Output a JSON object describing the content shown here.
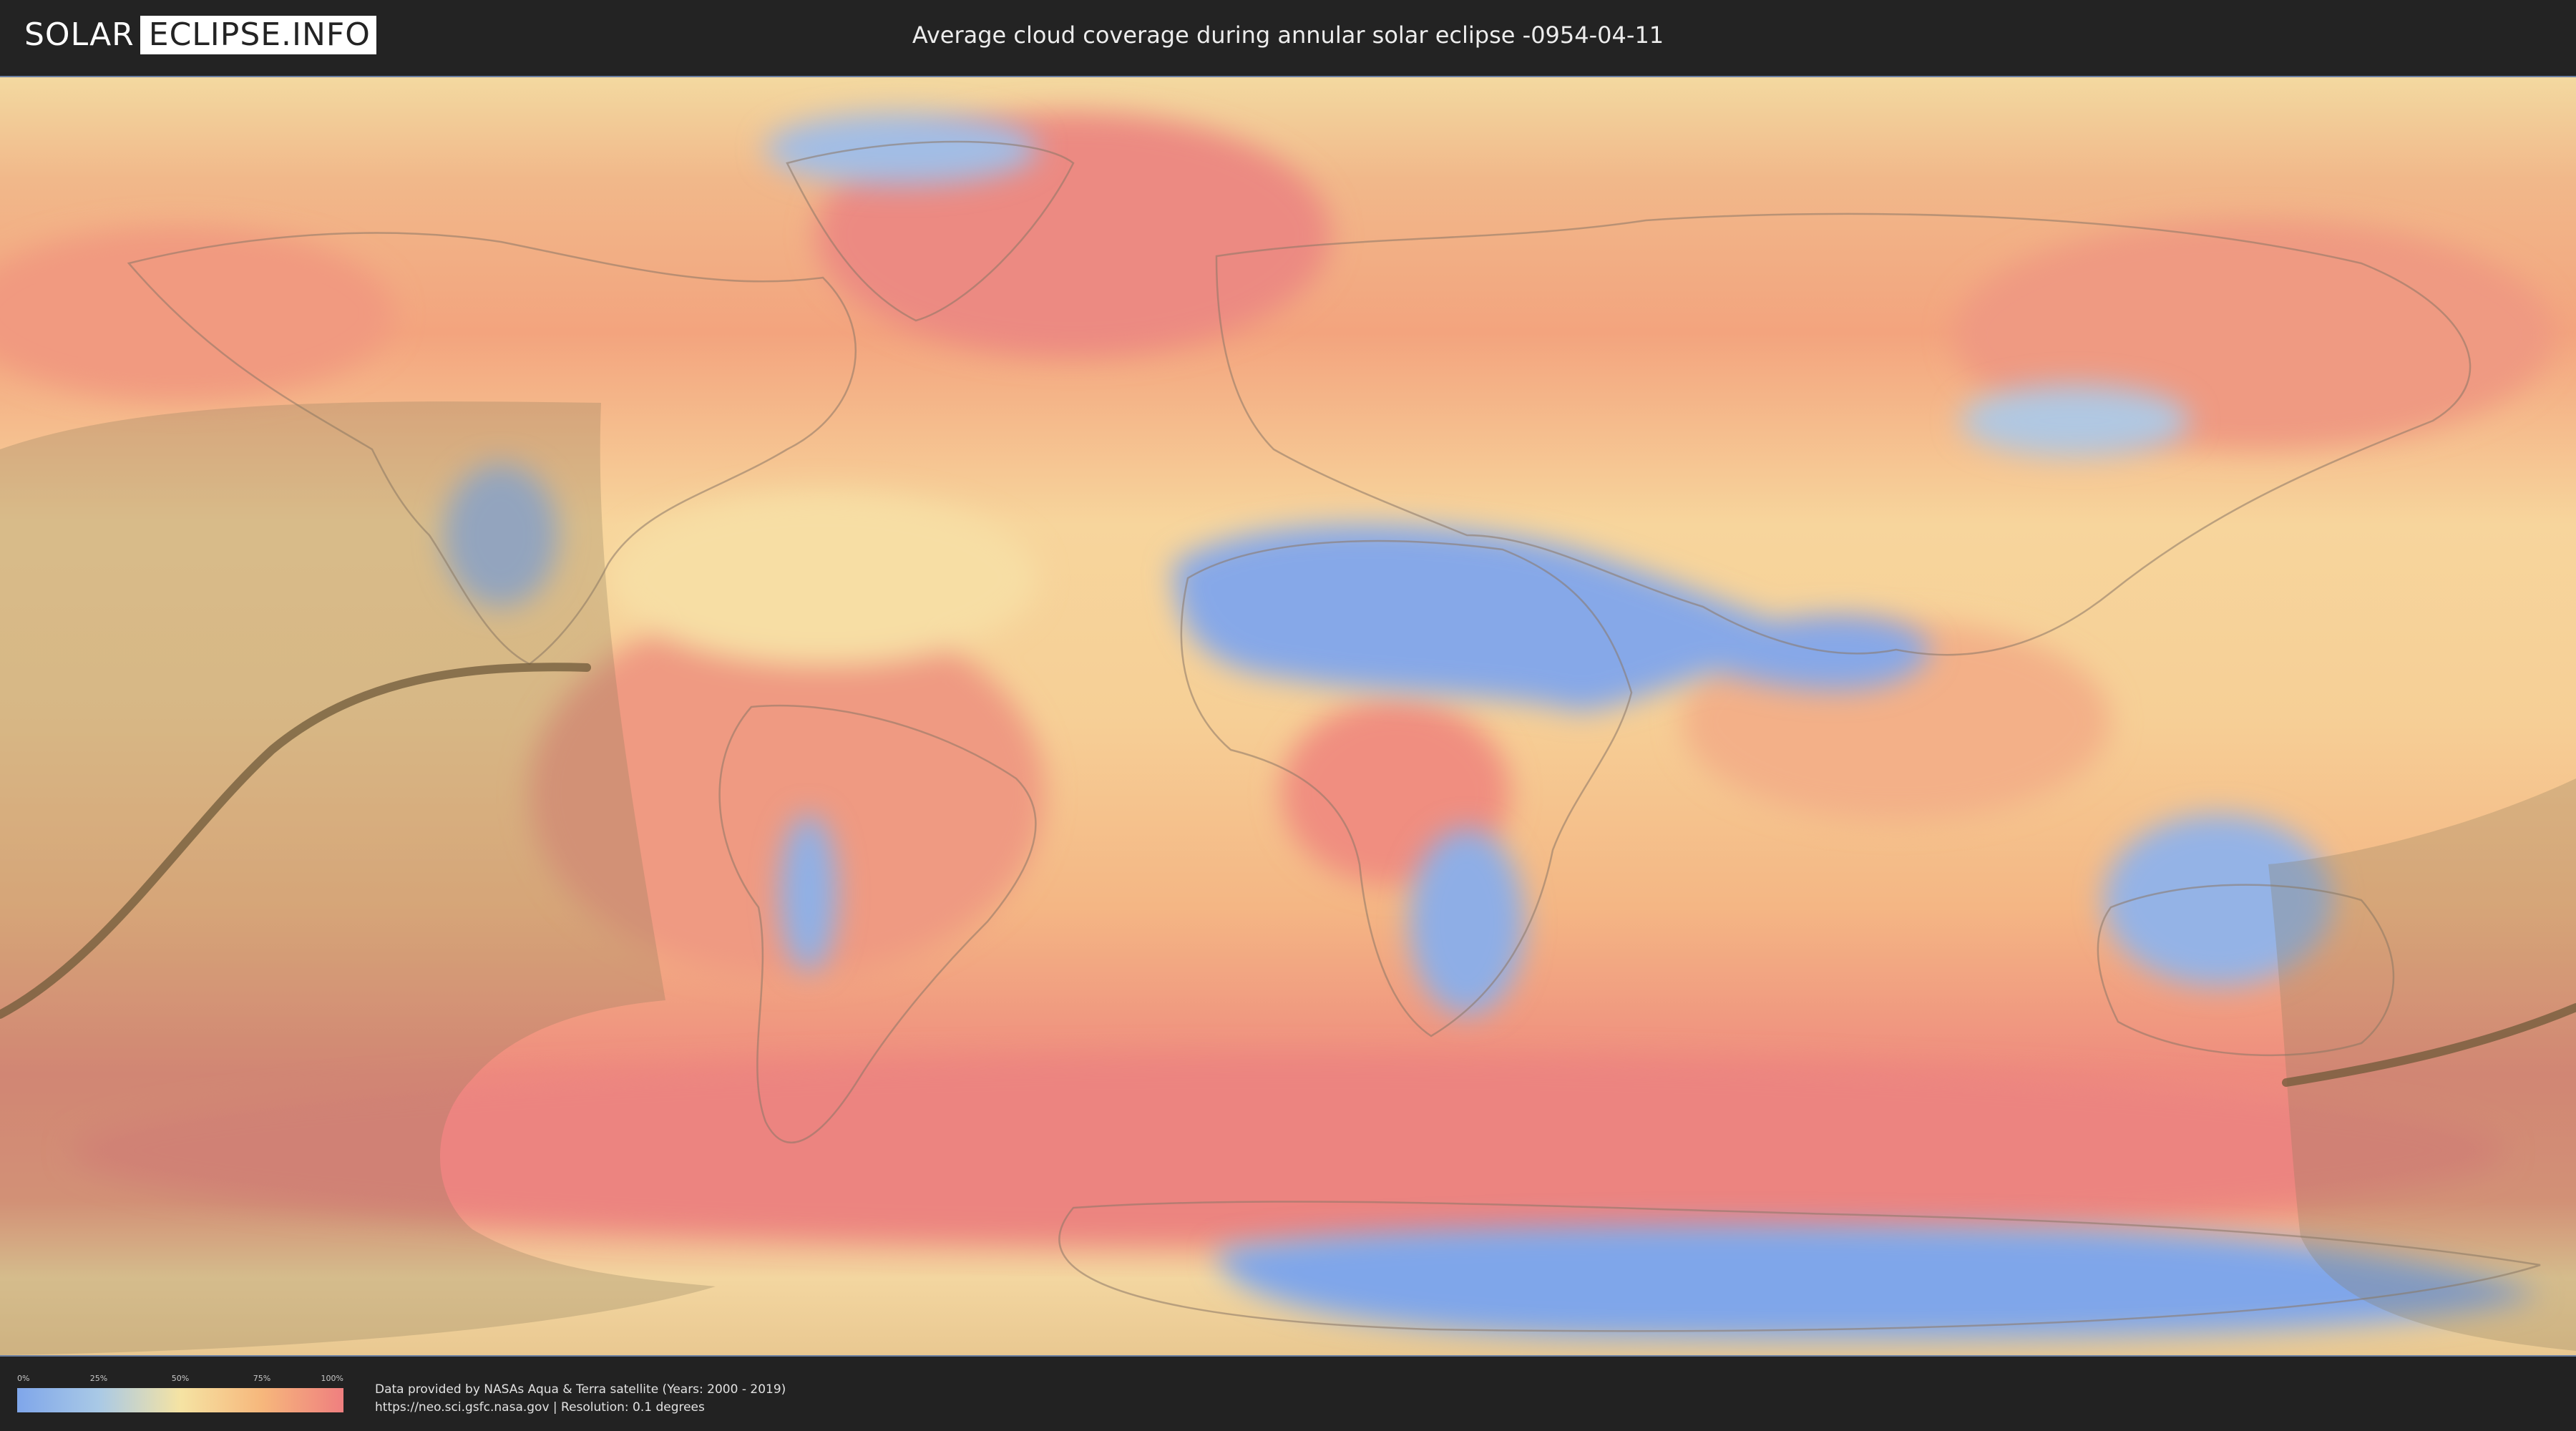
{
  "header": {
    "logo_left": "SOLAR",
    "logo_right": "ECLIPSE.INFO",
    "title": "Average cloud coverage during annular solar eclipse -0954-04-11"
  },
  "legend": {
    "ticks": [
      "0%",
      "25%",
      "50%",
      "75%",
      "100%"
    ],
    "colors": {
      "low": "#7fa6ea",
      "mid_low": "#a9c9e6",
      "mid": "#f5e3a3",
      "mid_high": "#f6b77c",
      "high": "#ef7f7f"
    }
  },
  "footer": {
    "credit_line1": "Data provided by NASAs Aqua & Terra satellite (Years: 2000 - 2019)",
    "credit_line2": "https://neo.sci.gsfc.nasa.gov | Resolution: 0.1 degrees"
  },
  "map": {
    "eclipse_path_color": "#6f5a3a",
    "visibility_shade_color": "#8a7a5a"
  }
}
